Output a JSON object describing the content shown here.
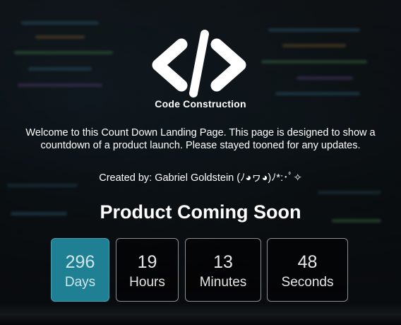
{
  "header": {
    "logo_icon": "code-brackets-icon",
    "brand": "Code Construction"
  },
  "intro": {
    "text": "Welcome to this Count Down Landing Page. This page is designed to show a countdown of a product launch. Please stayed tooned for any updates."
  },
  "credit": {
    "text": "Created by: Gabriel Goldstein (ﾉ◕ヮ◕)ﾉ*:･ﾟ✧"
  },
  "headline": "Product Coming Soon",
  "countdown": [
    {
      "value": "296",
      "unit": "Days",
      "active": true
    },
    {
      "value": "19",
      "unit": "Hours",
      "active": false
    },
    {
      "value": "13",
      "unit": "Minutes",
      "active": false
    },
    {
      "value": "48",
      "unit": "Seconds",
      "active": false
    }
  ],
  "colors": {
    "accent": "#1f7f93",
    "background": "#0d1114",
    "text": "#ffffff"
  }
}
